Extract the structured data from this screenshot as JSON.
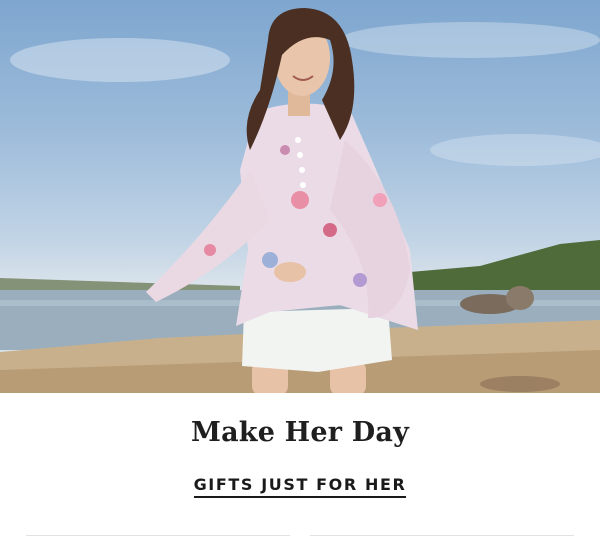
{
  "hero": {
    "alt": "Woman in a floral sheer blouse and white shorts on a beach"
  },
  "promo": {
    "headline": "Make Her Day",
    "cta_label": "GIFTS JUST FOR HER"
  },
  "colors": {
    "text": "#1f1f1f",
    "divider": "#e2e2e2"
  }
}
